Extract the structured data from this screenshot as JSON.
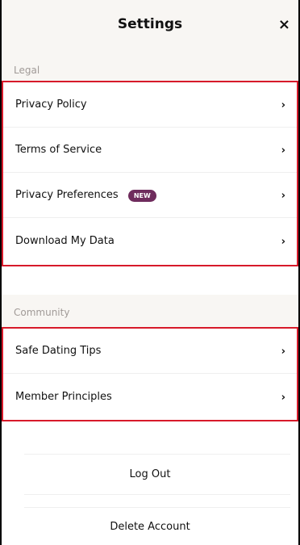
{
  "header": {
    "title": "Settings",
    "close_label": "×"
  },
  "legal": {
    "section_title": "Legal",
    "items": [
      {
        "label": "Privacy Policy",
        "badge": ""
      },
      {
        "label": "Terms of Service",
        "badge": ""
      },
      {
        "label": "Privacy Preferences",
        "badge": "NEW"
      },
      {
        "label": "Download My Data",
        "badge": ""
      }
    ]
  },
  "community": {
    "section_title": "Community",
    "items": [
      {
        "label": "Safe Dating Tips"
      },
      {
        "label": "Member Principles"
      }
    ]
  },
  "actions": {
    "logout": "Log Out",
    "delete": "Delete Account"
  },
  "colors": {
    "highlight": "#d71a2a",
    "badge": "#6f2c5d",
    "section_bg": "#f8f6f3"
  }
}
